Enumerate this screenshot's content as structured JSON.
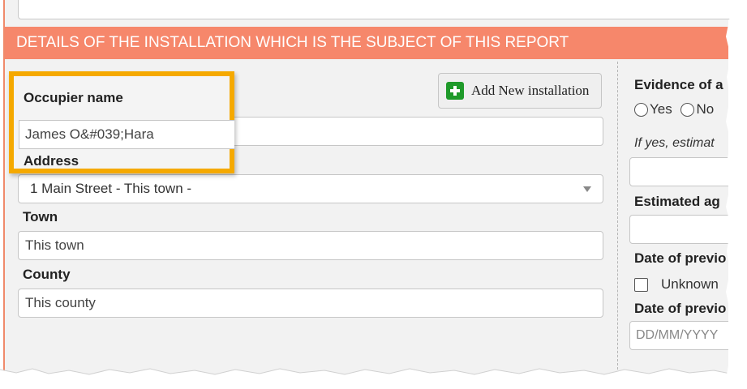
{
  "header": {
    "section_title": "DETAILS OF THE INSTALLATION WHICH IS THE SUBJECT OF THIS REPORT"
  },
  "left": {
    "add_button_label": "Add New installation",
    "occupier_label": "Occupier name",
    "occupier_value": "James O&#039;Hara",
    "address_label": "Address",
    "address_value": "1 Main Street - This town -",
    "town_label": "Town",
    "town_value": "This town",
    "county_label": "County",
    "county_value": "This county"
  },
  "right": {
    "evidence_label": "Evidence of a",
    "radio_yes": "Yes",
    "radio_no": "No",
    "if_yes_text": "If yes, estimat",
    "estimated_age_label": "Estimated ag",
    "date_prev_label_1": "Date of previo",
    "unknown_label": "Unknown",
    "date_prev_label_2": "Date of previo",
    "date_placeholder": "DD/MM/YYYY"
  },
  "colors": {
    "header_bg": "#f6876b",
    "highlight": "#f5a900",
    "add_icon": "#1f9a2a"
  }
}
